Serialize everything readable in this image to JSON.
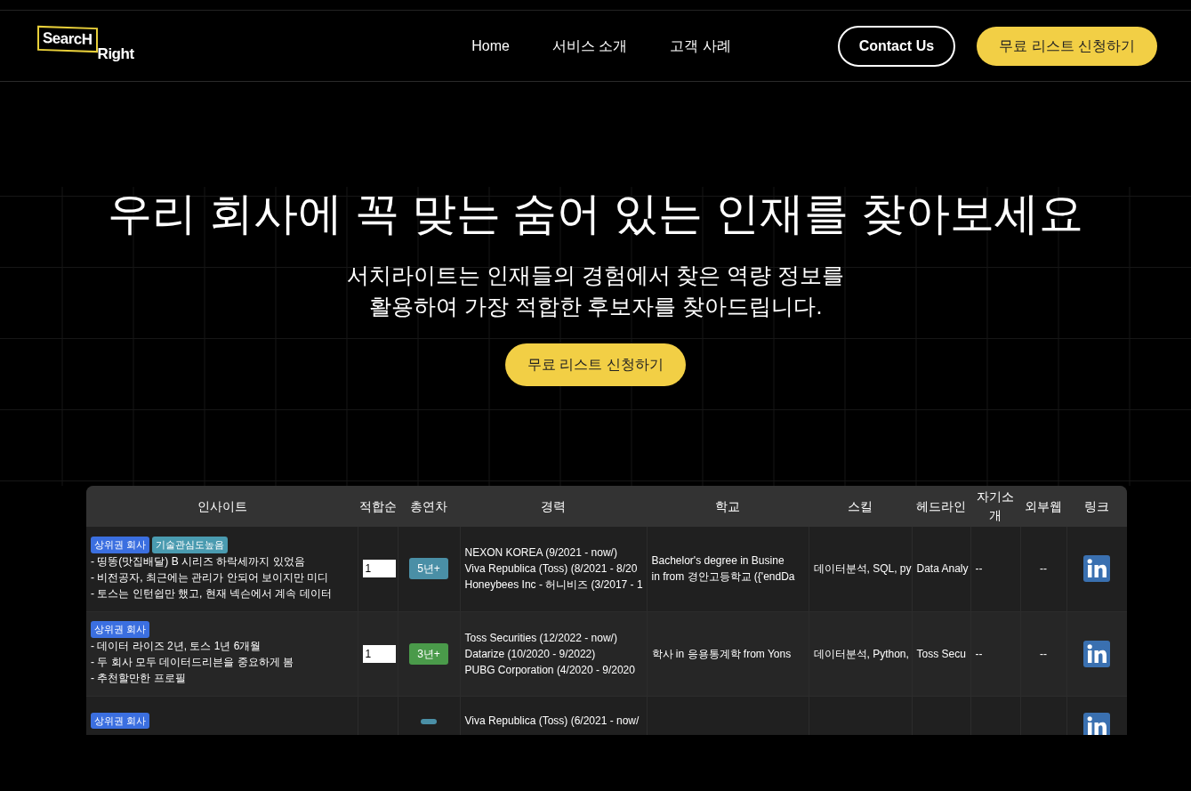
{
  "nav": {
    "logo": {
      "part_1": "SearcH",
      "part_2": "Right"
    },
    "links": [
      "Home",
      "서비스 소개",
      "고객 사례"
    ],
    "contact_button": "Contact Us",
    "cta_button": "무료 리스트 신청하기"
  },
  "hero": {
    "title": "우리 회사에 꼭 맞는 숨어 있는 인재를 찾아보세요",
    "subtitle_lines": [
      "서치라이트는 인재들의 경험에서 찾은 역량 정보를",
      "활용하여 가장 적합한 후보자를 찾아드립니다."
    ],
    "cta_button": "무료 리스트 신청하기"
  },
  "table": {
    "columns": [
      "인사이트",
      "적합순",
      "총연차",
      "경력",
      "학교",
      "스킬",
      "헤드라인",
      "자기소개",
      "외부웹",
      "링크"
    ],
    "rows": [
      {
        "tags": [
          {
            "label": "상위권 회사",
            "color": "#3b6fe0"
          },
          {
            "label": "기술관심도높음",
            "color": "#4a9bb0"
          }
        ],
        "insights": [
          "- 띵똥(맛집배달) B 시리즈 하락세까지 있었음",
          "- 비전공자, 최근에는 관리가 안되어 보이지만 미디",
          "- 토스는 인턴쉽만 했고, 현재 넥슨에서 계속 데이터"
        ],
        "rank": "1",
        "years": {
          "label": "5년+",
          "color": "#4a8fa6"
        },
        "experience": [
          "NEXON KOREA (9/2021 - now/)",
          "Viva Republica (Toss) (8/2021 - 8/20",
          "Honeybees Inc - 허니비즈 (3/2017 - 1"
        ],
        "school": [
          "Bachelor's degree in Busine",
          "in from 경안고등학교 ({'endDa"
        ],
        "skills": "데이터분석, SQL, py",
        "headline": "Data Analy",
        "intro": "--",
        "web": "--"
      },
      {
        "tags": [
          {
            "label": "상위권 회사",
            "color": "#3b6fe0"
          }
        ],
        "insights": [
          "- 데이터 라이즈 2년, 토스 1년 6개월",
          "- 두 회사 모두 데이터드리븐을 중요하게 봄",
          "- 추천할만한 프로필"
        ],
        "rank": "1",
        "years": {
          "label": "3년+",
          "color": "#4a9a4a"
        },
        "experience": [
          "Toss Securities (12/2022 - now/)",
          "Datarize (10/2020 - 9/2022)",
          "PUBG Corporation (4/2020 - 9/2020"
        ],
        "school": [
          "학사 in 응용통계학 from Yons"
        ],
        "skills": "데이터분석, Python,",
        "headline": "Toss Secu",
        "intro": "--",
        "web": "--"
      },
      {
        "tags": [
          {
            "label": "상위권 회사",
            "color": "#3b6fe0"
          }
        ],
        "insights": [],
        "years": {
          "color": "#4a8fa6"
        },
        "experience": [
          "Viva Republica (Toss) (6/2021 - now/"
        ],
        "school": []
      }
    ]
  }
}
